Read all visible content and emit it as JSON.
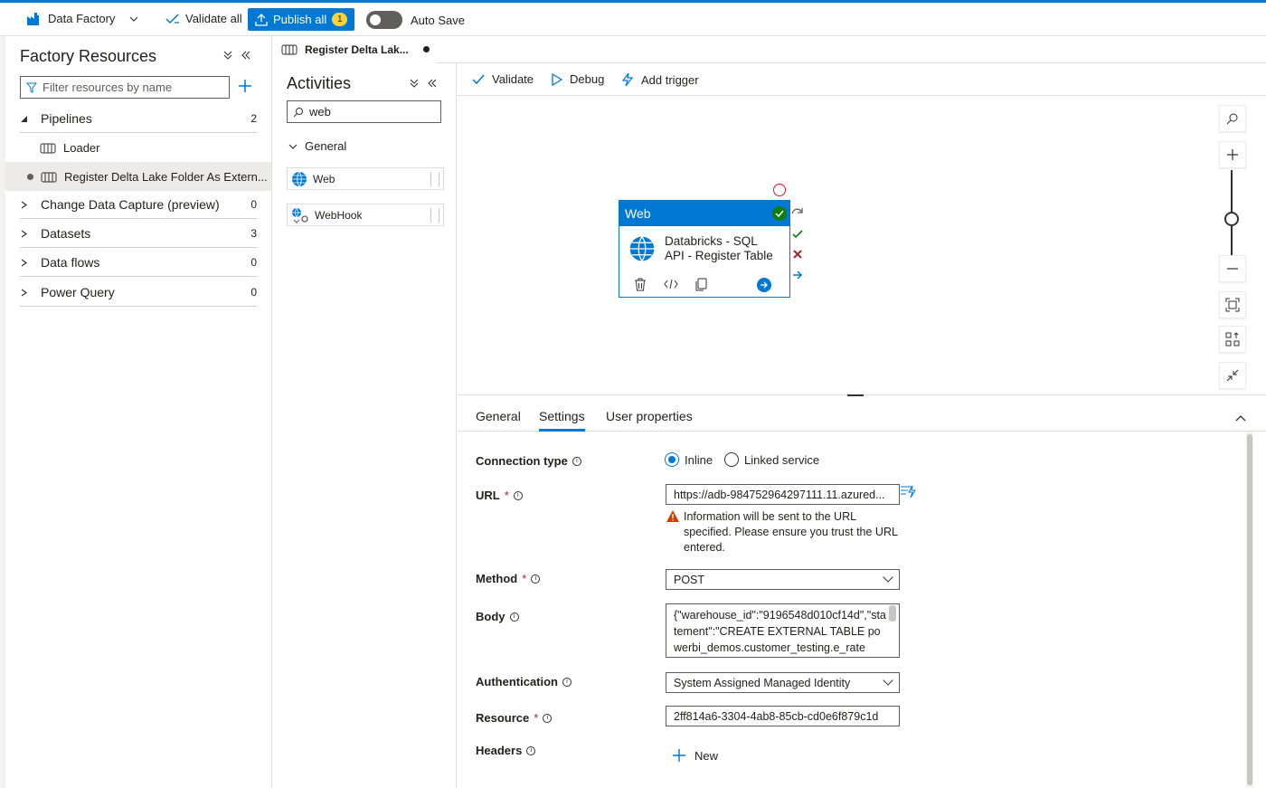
{
  "topbar": {
    "app_name": "Data Factory",
    "validate_all": "Validate all",
    "publish_all": "Publish all",
    "publish_count": "1",
    "auto_save": "Auto Save"
  },
  "factory": {
    "title": "Factory Resources",
    "filter_placeholder": "Filter resources by name",
    "groups": [
      {
        "label": "Pipelines",
        "count": "2"
      },
      {
        "label": "Change Data Capture (preview)",
        "count": "0"
      },
      {
        "label": "Datasets",
        "count": "3"
      },
      {
        "label": "Data flows",
        "count": "0"
      },
      {
        "label": "Power Query",
        "count": "0"
      }
    ],
    "pipelines": [
      "Loader",
      "Register Delta Lake Folder As Extern..."
    ]
  },
  "tab": {
    "label": "Register Delta Lak..."
  },
  "activities": {
    "title": "Activities",
    "search_value": "web",
    "section": "General",
    "items": [
      "Web",
      "WebHook"
    ]
  },
  "canvas_toolbar": {
    "validate": "Validate",
    "debug": "Debug",
    "add_trigger": "Add trigger"
  },
  "node": {
    "type": "Web",
    "name_line1": "Databricks - SQL",
    "name_line2": "API - Register Table"
  },
  "properties": {
    "tabs": [
      "General",
      "Settings",
      "User properties"
    ],
    "active_tab": "Settings",
    "connection_type_label": "Connection type",
    "connection_options": [
      "Inline",
      "Linked service"
    ],
    "url_label": "URL",
    "url_value": "https://adb-984752964297111.11.azured...",
    "url_warning": "Information will be sent to the URL specified. Please ensure you trust the URL entered.",
    "method_label": "Method",
    "method_value": "POST",
    "body_label": "Body",
    "body_value": "{\"warehouse_id\":\"9196548d010cf14d\",\"statement\":\"CREATE EXTERNAL TABLE powerbi_demos.customer_testing.e_rate",
    "auth_label": "Authentication",
    "auth_value": "System Assigned Managed Identity",
    "resource_label": "Resource",
    "resource_value": "2ff814a6-3304-4ab8-85cb-cd0e6f879c1d",
    "headers_label": "Headers",
    "new_label": "New"
  },
  "colors": {
    "accent": "#0078d4",
    "success": "#107c10",
    "error": "#a4262c",
    "warning": "#d83b01"
  }
}
